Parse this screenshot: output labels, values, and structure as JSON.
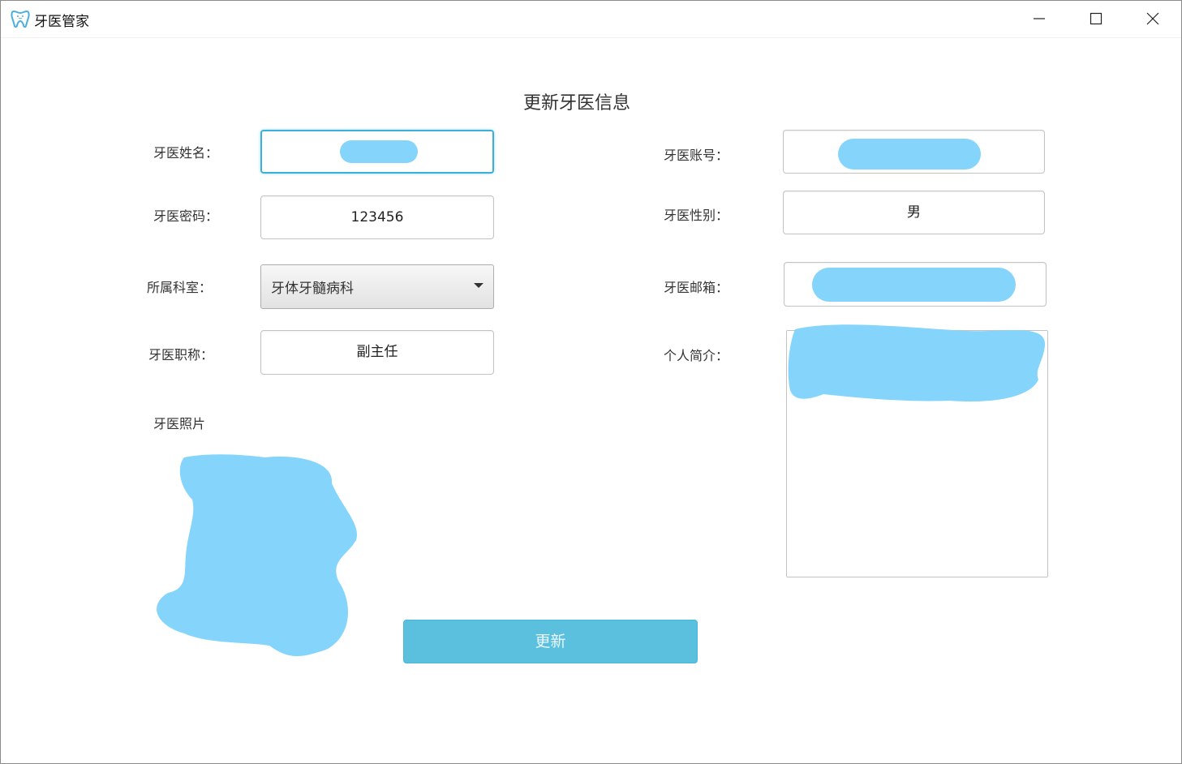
{
  "window": {
    "title": "牙医管家",
    "icon": "tooth-icon",
    "controls": [
      "minimize-icon",
      "maximize-icon",
      "close-icon"
    ]
  },
  "form": {
    "title": "更新牙医信息",
    "name": {
      "label": "牙医姓名：",
      "value": ""
    },
    "password": {
      "label": "牙医密码：",
      "value": "123456"
    },
    "department": {
      "label": "所属科室：",
      "value": "牙体牙髓病科"
    },
    "job_title": {
      "label": "牙医职称：",
      "value": "副主任"
    },
    "photo": {
      "label": "牙医照片"
    },
    "account": {
      "label": "牙医账号：",
      "value": ""
    },
    "gender": {
      "label": "牙医性别：",
      "value": "男"
    },
    "email": {
      "label": "牙医邮箱：",
      "value": ""
    },
    "intro": {
      "label": "个人简介：",
      "value": ""
    },
    "submit_label": "更新"
  },
  "colors": {
    "accent": "#5bc0de",
    "focus_border": "#3cb0d8",
    "redaction": "#84d4fb"
  }
}
